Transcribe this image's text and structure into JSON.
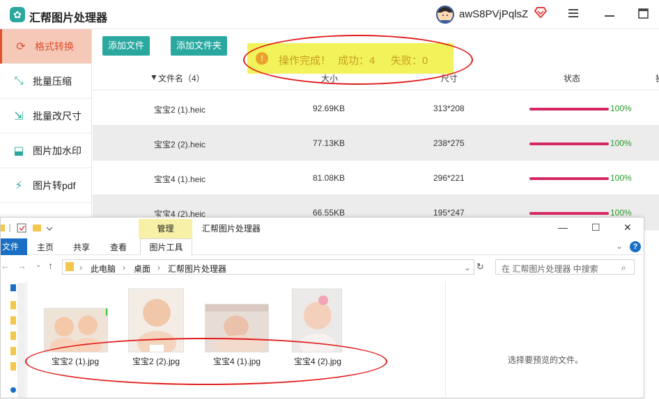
{
  "app": {
    "title": "汇帮图片处理器",
    "username": "awS8PVjPqlsZ",
    "vip_icon": "heart-diamond-icon",
    "menu_icon": "menu-icon",
    "minimize_icon": "minimize-icon",
    "maximize_icon": "maximize-icon"
  },
  "sidebar": {
    "items": [
      {
        "label": "格式转换",
        "icon": "convert-icon",
        "active": true
      },
      {
        "label": "批量压缩",
        "icon": "compress-icon",
        "active": false
      },
      {
        "label": "批量改尺寸",
        "icon": "resize-icon",
        "active": false
      },
      {
        "label": "图片加水印",
        "icon": "watermark-icon",
        "active": false
      },
      {
        "label": "图片转pdf",
        "icon": "pdf-icon",
        "active": false
      }
    ]
  },
  "toolbar": {
    "add_file": "添加文件",
    "add_folder": "添加文件夹"
  },
  "table": {
    "headers": {
      "filename": "文件名（4）",
      "size": "大小",
      "dimensions": "尺寸",
      "status": "状态",
      "more": "操"
    },
    "rows": [
      {
        "name": "宝宝2 (1).heic",
        "size": "92.69KB",
        "dim": "313*208",
        "progress": "100%"
      },
      {
        "name": "宝宝2 (2).heic",
        "size": "77.13KB",
        "dim": "238*275",
        "progress": "100%"
      },
      {
        "name": "宝宝4 (1).heic",
        "size": "81.08KB",
        "dim": "296*221",
        "progress": "100%"
      },
      {
        "name": "宝宝4 (2).heic",
        "size": "66.55KB",
        "dim": "195*247",
        "progress": "100%"
      }
    ]
  },
  "toast": {
    "icon": "info-icon",
    "message": "操作完成！",
    "success": "成功：4",
    "fail": "失败：0"
  },
  "explorer": {
    "manage": "管理",
    "title": "汇帮图片处理器",
    "ribbon": {
      "file": "文件",
      "home": "主页",
      "share": "共享",
      "view": "查看",
      "picture_tools": "图片工具"
    },
    "path": [
      "此电脑",
      "桌面",
      "汇帮图片处理器"
    ],
    "search_placeholder": "在 汇帮图片处理器 中搜索",
    "files": [
      {
        "name": "宝宝2 (1).jpg"
      },
      {
        "name": "宝宝2 (2).jpg"
      },
      {
        "name": "宝宝4 (1).jpg"
      },
      {
        "name": "宝宝4 (2).jpg"
      }
    ],
    "preview_text": "选择要预览的文件。"
  },
  "colors": {
    "accent": "#2aa8a0",
    "active": "#e0512c",
    "progress": "#d62860",
    "toast_bg": "#f2f25a",
    "annotation": "#e11a1a"
  }
}
